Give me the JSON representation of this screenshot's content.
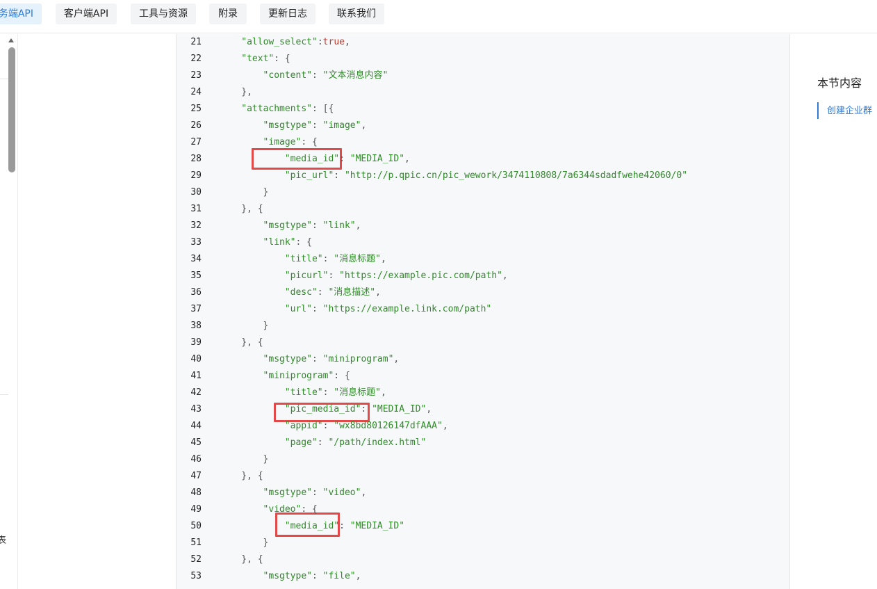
{
  "nav": {
    "tabs": [
      {
        "label": "务端API",
        "active": true
      },
      {
        "label": "客户端API",
        "active": false
      },
      {
        "label": "工具与资源",
        "active": false
      },
      {
        "label": "附录",
        "active": false
      },
      {
        "label": "更新日志",
        "active": false
      },
      {
        "label": "联系我们",
        "active": false
      }
    ]
  },
  "sidebar": {
    "clipped_text": "表"
  },
  "toc": {
    "title": "本节内容",
    "items": [
      "创建企业群"
    ]
  },
  "code": {
    "lines": [
      {
        "n": "21",
        "t": [
          [
            "s",
            "\"allow_select\""
          ],
          [
            "p",
            ":"
          ],
          [
            "kw",
            "true"
          ],
          [
            "p",
            ","
          ]
        ],
        "indent": 4
      },
      {
        "n": "22",
        "t": [
          [
            "s",
            "\"text\""
          ],
          [
            "p",
            ": {"
          ]
        ],
        "indent": 4
      },
      {
        "n": "23",
        "t": [
          [
            "s",
            "\"content\""
          ],
          [
            "p",
            ": "
          ],
          [
            "s",
            "\"文本消息内容\""
          ]
        ],
        "indent": 8
      },
      {
        "n": "24",
        "t": [
          [
            "p",
            "},"
          ]
        ],
        "indent": 4
      },
      {
        "n": "25",
        "t": [
          [
            "s",
            "\"attachments\""
          ],
          [
            "p",
            ": [{"
          ]
        ],
        "indent": 4
      },
      {
        "n": "26",
        "t": [
          [
            "s",
            "\"msgtype\""
          ],
          [
            "p",
            ": "
          ],
          [
            "s",
            "\"image\""
          ],
          [
            "p",
            ","
          ]
        ],
        "indent": 8
      },
      {
        "n": "27",
        "t": [
          [
            "s",
            "\"image\""
          ],
          [
            "p",
            ": {"
          ]
        ],
        "indent": 8
      },
      {
        "n": "28",
        "t": [
          [
            "s",
            "\"media_id\""
          ],
          [
            "p",
            ": "
          ],
          [
            "s",
            "\"MEDIA_ID\""
          ],
          [
            "p",
            ","
          ]
        ],
        "indent": 12
      },
      {
        "n": "29",
        "t": [
          [
            "s",
            "\"pic_url\""
          ],
          [
            "p",
            ": "
          ],
          [
            "s",
            "\"http://p.qpic.cn/pic_wework/3474110808/7a6344sdadfwehe42060/0\""
          ]
        ],
        "indent": 12
      },
      {
        "n": "30",
        "t": [
          [
            "p",
            "}"
          ]
        ],
        "indent": 8
      },
      {
        "n": "31",
        "t": [
          [
            "p",
            "}, {"
          ]
        ],
        "indent": 4
      },
      {
        "n": "32",
        "t": [
          [
            "s",
            "\"msgtype\""
          ],
          [
            "p",
            ": "
          ],
          [
            "s",
            "\"link\""
          ],
          [
            "p",
            ","
          ]
        ],
        "indent": 8
      },
      {
        "n": "33",
        "t": [
          [
            "s",
            "\"link\""
          ],
          [
            "p",
            ": {"
          ]
        ],
        "indent": 8
      },
      {
        "n": "34",
        "t": [
          [
            "s",
            "\"title\""
          ],
          [
            "p",
            ": "
          ],
          [
            "s",
            "\"消息标题\""
          ],
          [
            "p",
            ","
          ]
        ],
        "indent": 12
      },
      {
        "n": "35",
        "t": [
          [
            "s",
            "\"picurl\""
          ],
          [
            "p",
            ": "
          ],
          [
            "s",
            "\"https://example.pic.com/path\""
          ],
          [
            "p",
            ","
          ]
        ],
        "indent": 12
      },
      {
        "n": "36",
        "t": [
          [
            "s",
            "\"desc\""
          ],
          [
            "p",
            ": "
          ],
          [
            "s",
            "\"消息描述\""
          ],
          [
            "p",
            ","
          ]
        ],
        "indent": 12
      },
      {
        "n": "37",
        "t": [
          [
            "s",
            "\"url\""
          ],
          [
            "p",
            ": "
          ],
          [
            "s",
            "\"https://example.link.com/path\""
          ]
        ],
        "indent": 12
      },
      {
        "n": "38",
        "t": [
          [
            "p",
            "}"
          ]
        ],
        "indent": 8
      },
      {
        "n": "39",
        "t": [
          [
            "p",
            "}, {"
          ]
        ],
        "indent": 4
      },
      {
        "n": "40",
        "t": [
          [
            "s",
            "\"msgtype\""
          ],
          [
            "p",
            ": "
          ],
          [
            "s",
            "\"miniprogram\""
          ],
          [
            "p",
            ","
          ]
        ],
        "indent": 8
      },
      {
        "n": "41",
        "t": [
          [
            "s",
            "\"miniprogram\""
          ],
          [
            "p",
            ": {"
          ]
        ],
        "indent": 8
      },
      {
        "n": "42",
        "t": [
          [
            "s",
            "\"title\""
          ],
          [
            "p",
            ": "
          ],
          [
            "s",
            "\"消息标题\""
          ],
          [
            "p",
            ","
          ]
        ],
        "indent": 12
      },
      {
        "n": "43",
        "t": [
          [
            "s",
            "\"pic_media_id\""
          ],
          [
            "p",
            ": "
          ],
          [
            "s",
            "\"MEDIA_ID\""
          ],
          [
            "p",
            ","
          ]
        ],
        "indent": 12
      },
      {
        "n": "44",
        "t": [
          [
            "s",
            "\"appid\""
          ],
          [
            "p",
            ": "
          ],
          [
            "s",
            "\"wx8bd80126147dfAAA\""
          ],
          [
            "p",
            ","
          ]
        ],
        "indent": 12
      },
      {
        "n": "45",
        "t": [
          [
            "s",
            "\"page\""
          ],
          [
            "p",
            ": "
          ],
          [
            "s",
            "\"/path/index.html\""
          ]
        ],
        "indent": 12
      },
      {
        "n": "46",
        "t": [
          [
            "p",
            "}"
          ]
        ],
        "indent": 8
      },
      {
        "n": "47",
        "t": [
          [
            "p",
            "}, {"
          ]
        ],
        "indent": 4
      },
      {
        "n": "48",
        "t": [
          [
            "s",
            "\"msgtype\""
          ],
          [
            "p",
            ": "
          ],
          [
            "s",
            "\"video\""
          ],
          [
            "p",
            ","
          ]
        ],
        "indent": 8
      },
      {
        "n": "49",
        "t": [
          [
            "s",
            "\"video\""
          ],
          [
            "p",
            ": {"
          ]
        ],
        "indent": 8
      },
      {
        "n": "50",
        "t": [
          [
            "s",
            "\"media_id\""
          ],
          [
            "p",
            ": "
          ],
          [
            "s",
            "\"MEDIA_ID\""
          ]
        ],
        "indent": 12
      },
      {
        "n": "51",
        "t": [
          [
            "p",
            "}"
          ]
        ],
        "indent": 8
      },
      {
        "n": "52",
        "t": [
          [
            "p",
            "}, {"
          ]
        ],
        "indent": 4
      },
      {
        "n": "53",
        "t": [
          [
            "s",
            "\"msgtype\""
          ],
          [
            "p",
            ": "
          ],
          [
            "s",
            "\"file\""
          ],
          [
            "p",
            ","
          ]
        ],
        "indent": 8
      }
    ],
    "highlighted_lines": [
      "28",
      "43",
      "50"
    ]
  },
  "colors": {
    "accent": "#2f7bd6",
    "string": "#2e8b26",
    "keyword": "#c0392b",
    "highlight": "#e24a4a",
    "code_bg": "#f6f8fa"
  }
}
